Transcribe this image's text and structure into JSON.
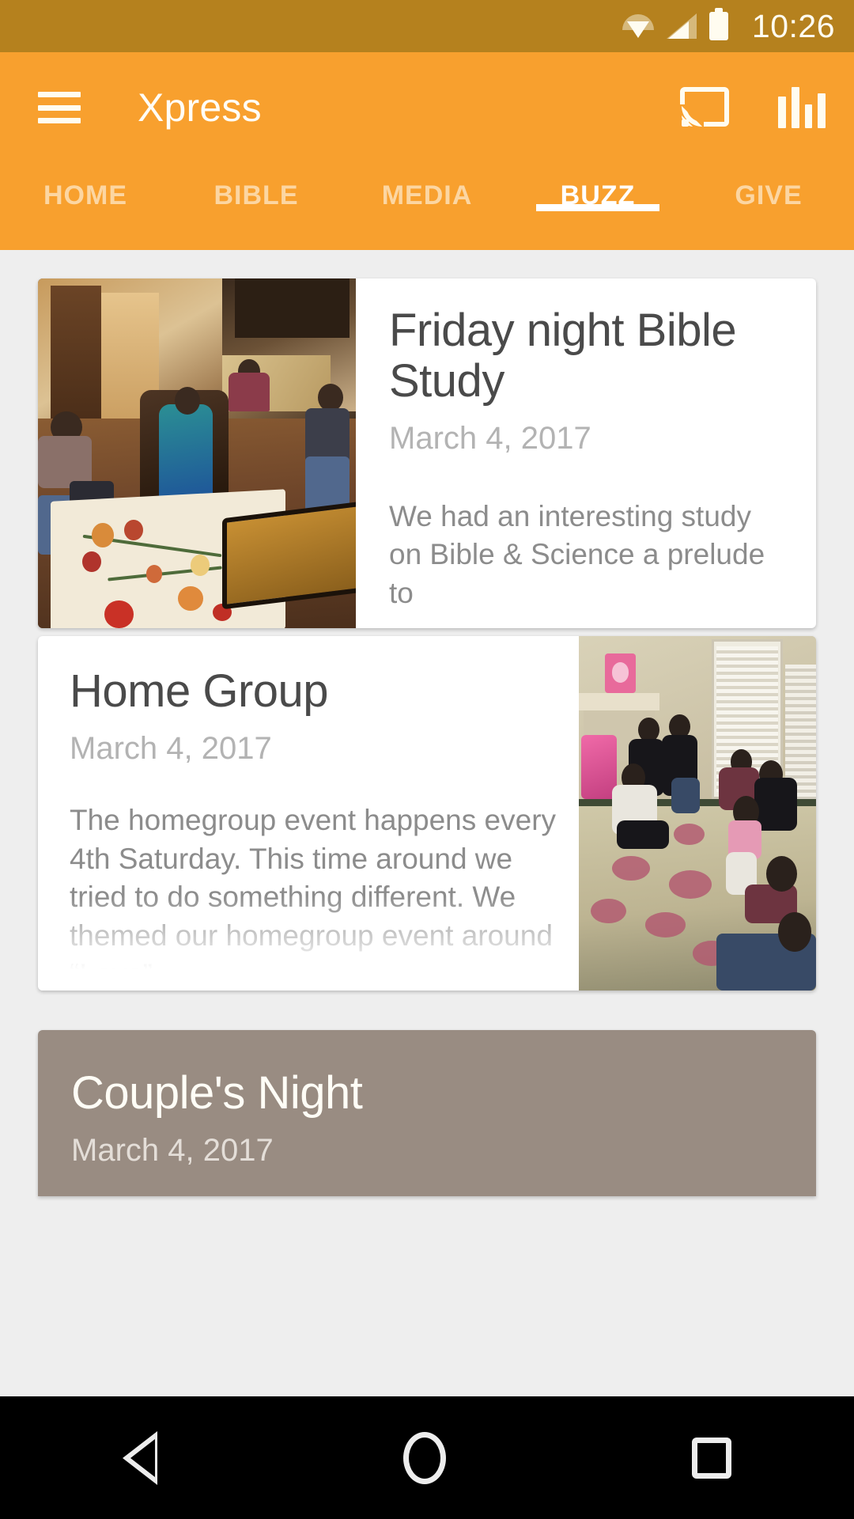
{
  "status_bar": {
    "time": "10:26",
    "icons": [
      "wifi-icon",
      "cellular-signal-icon",
      "battery-icon"
    ]
  },
  "app_bar": {
    "menu_icon": "hamburger-menu-icon",
    "title": "Xpress",
    "actions": [
      {
        "icon": "cast-icon",
        "label": "Cast"
      },
      {
        "icon": "bar-chart-icon",
        "label": "Stats"
      }
    ],
    "accent_color": "#f8a02e",
    "status_bar_color": "#b5811e"
  },
  "tabs": {
    "active": "BUZZ",
    "items": [
      {
        "label": "HOME",
        "active": false
      },
      {
        "label": "BIBLE",
        "active": false
      },
      {
        "label": "MEDIA",
        "active": false
      },
      {
        "label": "BUZZ",
        "active": true
      },
      {
        "label": "GIVE",
        "active": false
      }
    ]
  },
  "feed": {
    "cards": [
      {
        "title": "Friday night Bible Study",
        "date": "March 4, 2017",
        "excerpt": "We had an interesting study on Bible & Science a prelude to",
        "image_position": "left",
        "image_alt": "Group of women seated in a living room for a Bible study"
      },
      {
        "title": "Home Group",
        "date": "March 4, 2017",
        "excerpt": "The homegroup event happens every 4th Saturday. This time around we tried to do something different. We themed our homegroup event around “Love”",
        "image_position": "right",
        "image_alt": "Home group gathering sitting on a floral rug in a living room"
      },
      {
        "title": "Couple's Night",
        "date": "March 4, 2017",
        "excerpt": "",
        "image_position": "none",
        "background_color": "#998c82",
        "image_alt": "Partially visible card with muted taupe background"
      }
    ]
  },
  "navigation_bar": {
    "buttons": [
      {
        "icon": "back-triangle-icon",
        "label": "Back"
      },
      {
        "icon": "home-circle-icon",
        "label": "Home"
      },
      {
        "icon": "recents-square-icon",
        "label": "Recents"
      }
    ]
  }
}
